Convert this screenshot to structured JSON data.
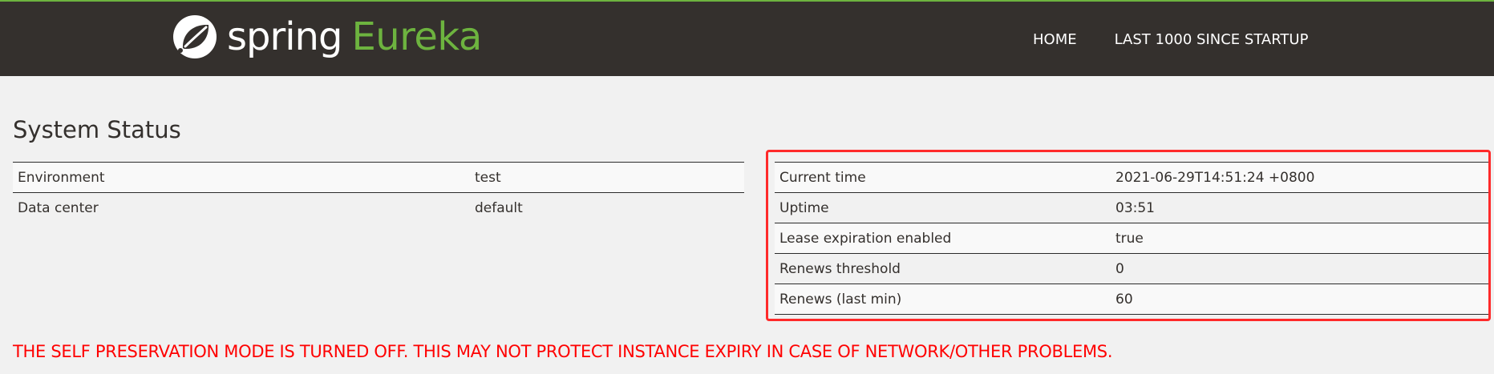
{
  "brand": {
    "spring": "spring",
    "eureka": "Eureka"
  },
  "nav": {
    "home": "HOME",
    "last1000": "LAST 1000 SINCE STARTUP"
  },
  "system_status": {
    "title": "System Status",
    "left_rows": [
      {
        "label": "Environment",
        "value": "test"
      },
      {
        "label": "Data center",
        "value": "default"
      }
    ],
    "right_rows": [
      {
        "label": "Current time",
        "value": "2021-06-29T14:51:24 +0800"
      },
      {
        "label": "Uptime",
        "value": "03:51"
      },
      {
        "label": "Lease expiration enabled",
        "value": "true"
      },
      {
        "label": "Renews threshold",
        "value": "0"
      },
      {
        "label": "Renews (last min)",
        "value": "60"
      }
    ]
  },
  "warning": "THE SELF PRESERVATION MODE IS TURNED OFF. THIS MAY NOT PROTECT INSTANCE EXPIRY IN CASE OF NETWORK/OTHER PROBLEMS.",
  "colors": {
    "navbar_bg": "#34302d",
    "brand_green": "#6db33f",
    "warning_red": "#ff0000",
    "highlight_red": "#ff2a2a"
  },
  "icons": {
    "logo": "spring-leaf-icon"
  }
}
